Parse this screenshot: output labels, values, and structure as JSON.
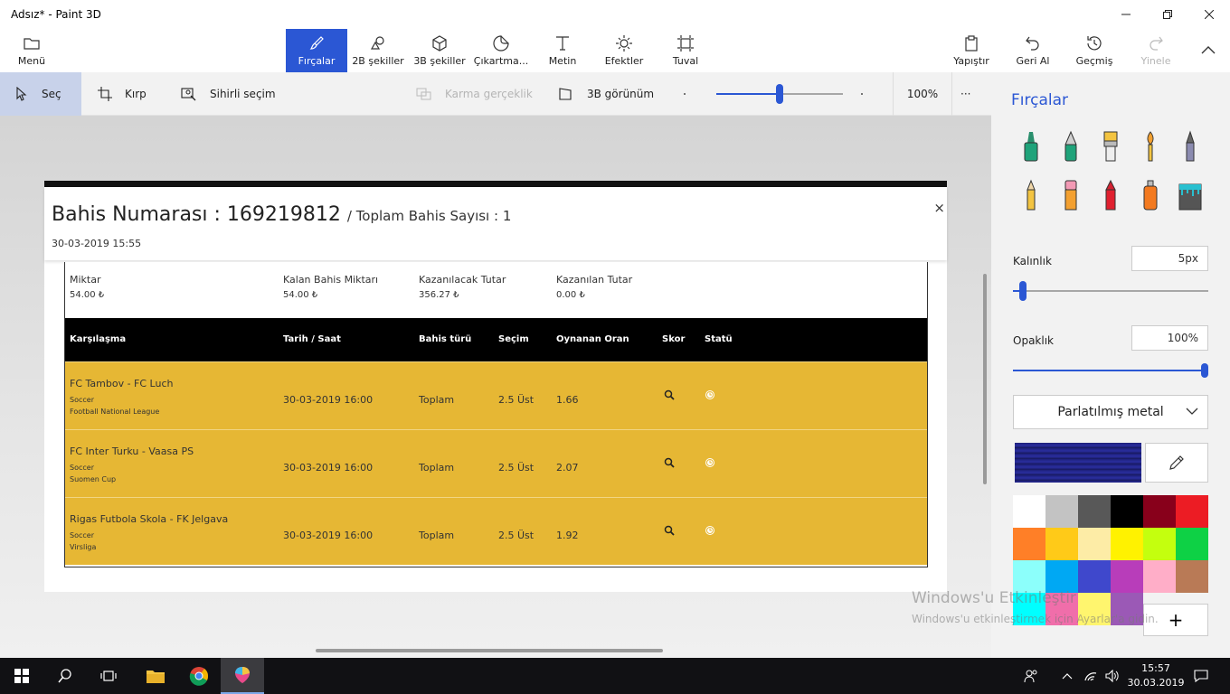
{
  "window": {
    "title": "Adsız* - Paint 3D"
  },
  "ribbon": {
    "menu": "Menü",
    "tools": [
      "Fırçalar",
      "2B şekiller",
      "3B şekiller",
      "Çıkartma...",
      "Metin",
      "Efektler",
      "Tuval"
    ],
    "paste": "Yapıştır",
    "undo": "Geri Al",
    "history": "Geçmiş",
    "redo": "Yinele"
  },
  "toolbar": {
    "select": "Seç",
    "crop": "Kırp",
    "magic_select": "Sihirli seçim",
    "mixed_reality": "Karma gerçeklik",
    "view_3d": "3B görünüm",
    "zoom_value": 100,
    "zoom_label": "100%",
    "more": "···"
  },
  "document": {
    "bet_title": "Bahis Numarası : 169219812",
    "bet_subtitle": "/ Toplam Bahis Sayısı : 1",
    "bet_date": "30-03-2019 15:55",
    "close": "×",
    "summary": [
      {
        "label": "Miktar",
        "value": "54.00 ₺"
      },
      {
        "label": "Kalan Bahis Miktarı",
        "value": "54.00 ₺"
      },
      {
        "label": "Kazanılacak Tutar",
        "value": "356.27 ₺"
      },
      {
        "label": "Kazanılan Tutar",
        "value": "0.00 ₺"
      }
    ],
    "columns": [
      "Karşılaşma",
      "Tarih / Saat",
      "Bahis türü",
      "Seçim",
      "Oynanan Oran",
      "Skor",
      "Statü"
    ],
    "rows": [
      {
        "match": "FC Tambov - FC Luch",
        "sport": "Soccer",
        "league": "Football National League",
        "datetime": "30-03-2019 16:00",
        "type": "Toplam",
        "selection": "2.5 Üst",
        "odds": "1.66"
      },
      {
        "match": "FC Inter Turku - Vaasa PS",
        "sport": "Soccer",
        "league": "Suomen Cup",
        "datetime": "30-03-2019 16:00",
        "type": "Toplam",
        "selection": "2.5 Üst",
        "odds": "2.07"
      },
      {
        "match": "Rigas Futbola Skola - FK Jelgava",
        "sport": "Soccer",
        "league": "Virsliga",
        "datetime": "30-03-2019 16:00",
        "type": "Toplam",
        "selection": "2.5 Üst",
        "odds": "1.92"
      }
    ]
  },
  "panel": {
    "title": "Fırçalar",
    "thickness_label": "Kalınlık",
    "thickness_value": "5px",
    "thickness_level": 0.05,
    "opacity_label": "Opaklık",
    "opacity_value": "100%",
    "opacity_level": 1.0,
    "material": "Parlatılmış metal",
    "brushes": [
      "marker-icon",
      "calligraphy-pen-icon",
      "oil-brush-icon",
      "watercolor-icon",
      "pixel-pen-icon",
      "pencil-icon",
      "eraser-icon",
      "crayon-icon",
      "spray-can-icon",
      "fill-bucket-icon"
    ],
    "palette": [
      "#ffffff",
      "#c3c3c3",
      "#585858",
      "#000000",
      "#88001b",
      "#ec1c24",
      "#ff7f27",
      "#ffca18",
      "#fdeca6",
      "#fff200",
      "#c4ff0e",
      "#0ed145",
      "#8cfffb",
      "#00a8f3",
      "#3f48cc",
      "#b83dba",
      "#ffaec8",
      "#b97a56",
      "#00ffff",
      "#f06eaa",
      "#fff56e",
      "#9b59b6"
    ],
    "add_color": "+"
  },
  "watermark": {
    "line1": "Windows'u Etkinleştir",
    "line2": "Windows'u etkinleştirmek için Ayarlar'a gidin."
  },
  "taskbar": {
    "time": "15:57",
    "date": "30.03.2019"
  },
  "colors": {
    "accent": "#2b57d4",
    "row_bg": "#e6b734",
    "header_bg": "#000000"
  }
}
